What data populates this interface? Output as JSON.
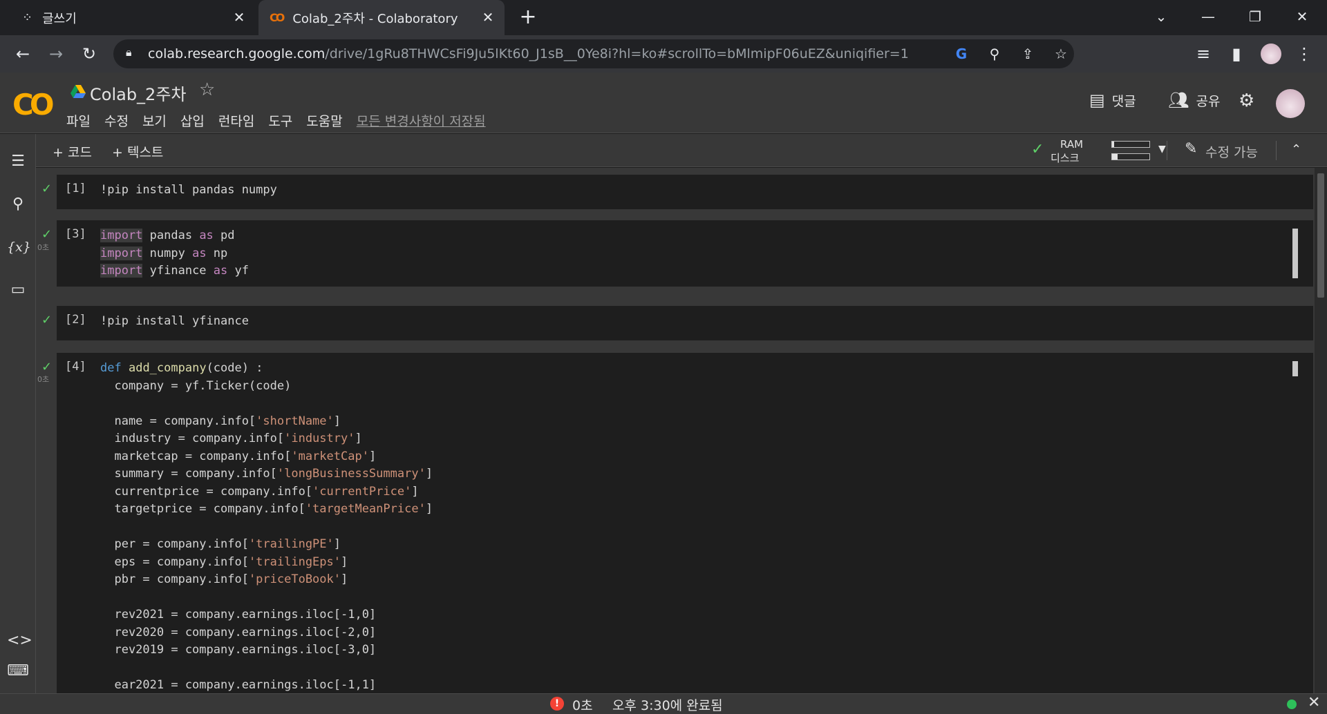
{
  "browser": {
    "tabs": [
      {
        "title": "글쓰기",
        "icon": "dots-favicon-icon"
      },
      {
        "title": "Colab_2주차 - Colaboratory",
        "icon": "colab-favicon-icon"
      }
    ],
    "url_domain": "colab.research.google.com",
    "url_path": "/drive/1gRu8THWCsFi9Ju5lKt60_J1sB__0Ye8i?hl=ko#scrollTo=bMlmipF06uEZ&uniqifier=1"
  },
  "colab": {
    "logo": "CO",
    "doc_name": "Colab_2주차",
    "menu": [
      "파일",
      "수정",
      "보기",
      "삽입",
      "런타임",
      "도구",
      "도움말"
    ],
    "saved_status": "모든 변경사항이 저장됨",
    "comment_label": "댓글",
    "share_label": "공유",
    "toolbar": {
      "add_code": "+ 코드",
      "add_text": "+ 텍스트",
      "ram_label": "RAM",
      "disk_label": "디스크",
      "ram_fraction": 0.05,
      "disk_fraction": 0.15,
      "edit_mode": "수정 가능"
    }
  },
  "cells": [
    {
      "exec": "[1]",
      "time": ""
    },
    {
      "exec": "[3]",
      "time": "0초"
    },
    {
      "exec": "[2]",
      "time": ""
    },
    {
      "exec": "[4]",
      "time": "0초"
    }
  ],
  "status": {
    "elapsed": "0초",
    "done": "오후 3:30에 완료됨"
  }
}
